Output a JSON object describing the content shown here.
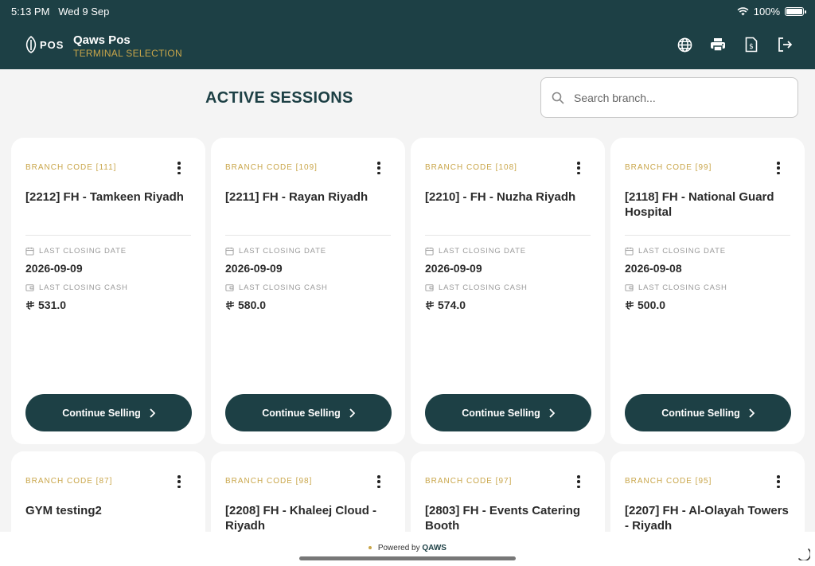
{
  "status_bar": {
    "time": "5:13 PM",
    "date": "Wed 9 Sep",
    "battery": "100%",
    "wifi_icon": "wifi-icon",
    "battery_icon": "battery-icon"
  },
  "header": {
    "logo_text": "POS",
    "title": "Qaws Pos",
    "subtitle": "TERMINAL SELECTION",
    "icons": [
      "globe-icon",
      "printer-icon",
      "invoice-icon",
      "logout-icon"
    ]
  },
  "page": {
    "title": "ACTIVE SESSIONS"
  },
  "search": {
    "placeholder": "Search branch...",
    "value": ""
  },
  "labels": {
    "last_closing_date": "LAST CLOSING DATE",
    "last_closing_cash": "LAST CLOSING CASH",
    "continue": "Continue Selling"
  },
  "colors": {
    "primary": "#1d4045",
    "accent": "#c9a64a",
    "background": "#f4f4f4"
  },
  "cards": [
    {
      "branch_code": "BRANCH CODE [111]",
      "name": "[2212] FH - Tamkeen Riyadh",
      "closing_date": "2026-09-09",
      "closing_cash": "531.0"
    },
    {
      "branch_code": "BRANCH CODE [109]",
      "name": "[2211] FH - Rayan Riyadh",
      "closing_date": "2026-09-09",
      "closing_cash": "580.0"
    },
    {
      "branch_code": "BRANCH CODE [108]",
      "name": "[2210] - FH - Nuzha Riyadh",
      "closing_date": "2026-09-09",
      "closing_cash": "574.0"
    },
    {
      "branch_code": "BRANCH CODE [99]",
      "name": "[2118] FH - National Guard Hospital",
      "closing_date": "2026-09-08",
      "closing_cash": "500.0"
    },
    {
      "branch_code": "BRANCH CODE [87]",
      "name": "GYM testing2"
    },
    {
      "branch_code": "BRANCH CODE [98]",
      "name": "[2208] FH - Khaleej Cloud - Riyadh"
    },
    {
      "branch_code": "BRANCH CODE [97]",
      "name": "[2803] FH - Events Catering Booth"
    },
    {
      "branch_code": "BRANCH CODE [95]",
      "name": "[2207] FH - Al-Olayah Towers - Riyadh"
    }
  ],
  "footer": {
    "powered_prefix": "Powered by",
    "brand": "QAWS"
  }
}
